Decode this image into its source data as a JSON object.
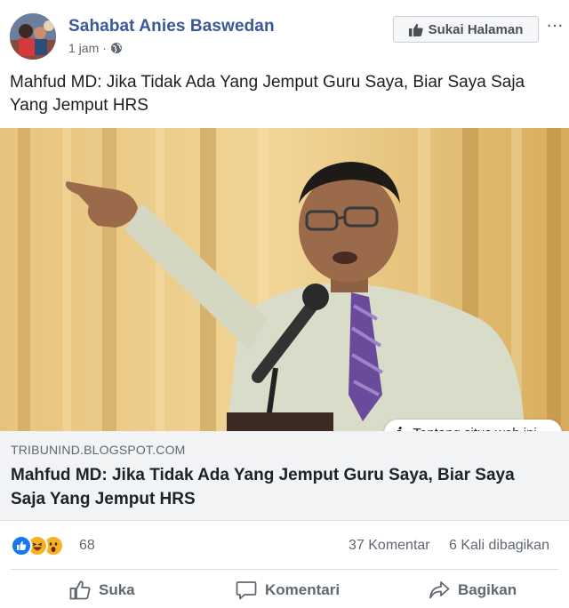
{
  "header": {
    "page_name": "Sahabat Anies Baswedan",
    "time": "1 jam",
    "separator": "·",
    "like_page_label": "Sukai Halaman",
    "more_label": "···"
  },
  "post": {
    "caption": "Mahfud MD: Jika Tidak Ada Yang Jemput Guru Saya, Biar Saya Saja Yang Jemput HRS"
  },
  "link": {
    "domain": "TRIBUNIND.BLOGSPOT.COM",
    "title": "Mahfud MD: Jika Tidak Ada Yang Jemput Guru Saya, Biar Saya Saja Yang Jemput HRS",
    "site_info_label": "Tentang situs web ini",
    "site_info_icon": "i"
  },
  "stats": {
    "reaction_icons": [
      "like-icon",
      "haha-icon",
      "wow-icon"
    ],
    "reaction_count": "68",
    "comments": "37 Komentar",
    "shares": "6 Kali dibagikan"
  },
  "actions": {
    "like": "Suka",
    "comment": "Komentari",
    "share": "Bagikan"
  },
  "colors": {
    "page_name": "#385898",
    "like_blue": "#1877f2",
    "reaction_yellow": "#f7b125"
  }
}
